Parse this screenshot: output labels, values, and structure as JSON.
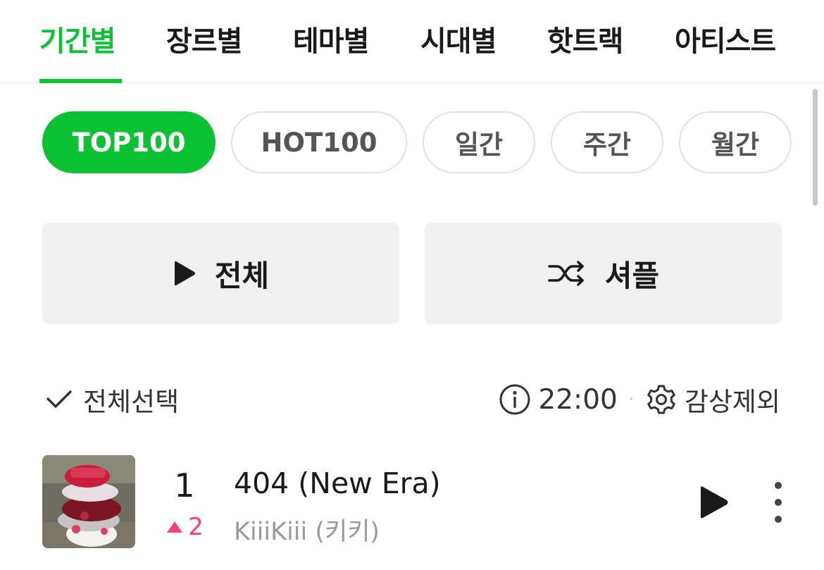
{
  "tabs": [
    {
      "label": "기간별",
      "active": true
    },
    {
      "label": "장르별",
      "active": false
    },
    {
      "label": "테마별",
      "active": false
    },
    {
      "label": "시대별",
      "active": false
    },
    {
      "label": "핫트랙",
      "active": false
    },
    {
      "label": "아티스트",
      "active": false
    }
  ],
  "chips": [
    {
      "label": "TOP100",
      "active": true
    },
    {
      "label": "HOT100",
      "active": false
    },
    {
      "label": "일간",
      "active": false
    },
    {
      "label": "주간",
      "active": false
    },
    {
      "label": "월간",
      "active": false
    }
  ],
  "actions": {
    "play_all_label": "전체",
    "play_all_icon": "play-icon",
    "shuffle_label": "셔플",
    "shuffle_icon": "shuffle-icon"
  },
  "toolbar": {
    "select_all_label": "전체선택",
    "select_all_icon": "check-icon",
    "info_icon": "info-icon",
    "update_time": "22:00",
    "separator": "·",
    "settings_icon": "gear-icon",
    "exclude_label": "감상제외"
  },
  "songs": [
    {
      "rank": "1",
      "rank_change": "2",
      "rank_change_direction": "up",
      "title": "404 (New Era)",
      "artist": "KiiiKiii (키키)",
      "cover_icon": "album-cover"
    }
  ],
  "colors": {
    "accent": "#0bc232",
    "rank_up": "#ff3d7f",
    "secondary_text": "#9a9a9a"
  }
}
